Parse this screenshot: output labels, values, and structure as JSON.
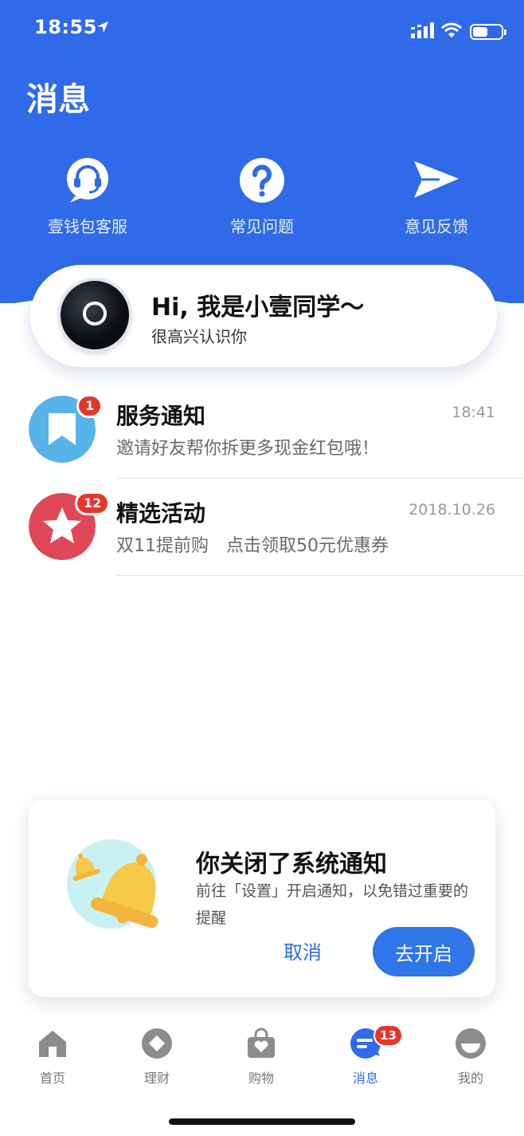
{
  "status_bar": {
    "time": "18:55"
  },
  "header": {
    "title": "消息"
  },
  "quick_actions": [
    {
      "label": "壹钱包客服",
      "icon": "headset-icon"
    },
    {
      "label": "常见问题",
      "icon": "question-icon"
    },
    {
      "label": "意见反馈",
      "icon": "send-icon"
    }
  ],
  "assistant": {
    "title": "Hi, 我是小壹同学～",
    "subtitle": "很高兴认识你"
  },
  "messages": [
    {
      "title": "服务通知",
      "time": "18:41",
      "preview": "邀请好友帮你拆更多现金红包哦！",
      "badge": "1",
      "icon": "bookmark-icon",
      "color": "#57b3ea"
    },
    {
      "title": "精选活动",
      "time": "2018.10.26",
      "preview": "双11提前购　点击领取50元优惠券",
      "badge": "12",
      "icon": "star-icon",
      "color": "#e0485a"
    }
  ],
  "notice": {
    "title": "你关闭了系统通知",
    "description": "前往「设置」开启通知，以免错过重要的提醒",
    "cancel_label": "取消",
    "confirm_label": "去开启"
  },
  "tab_bar": {
    "items": [
      {
        "label": "首页",
        "icon": "home-icon"
      },
      {
        "label": "理财",
        "icon": "finance-icon"
      },
      {
        "label": "购物",
        "icon": "shopping-bag-icon"
      },
      {
        "label": "消息",
        "icon": "message-icon",
        "badge": "13",
        "active": true
      },
      {
        "label": "我的",
        "icon": "profile-icon"
      }
    ]
  },
  "colors": {
    "brand_blue": "#2f6be8",
    "badge_red": "#e8352a"
  }
}
